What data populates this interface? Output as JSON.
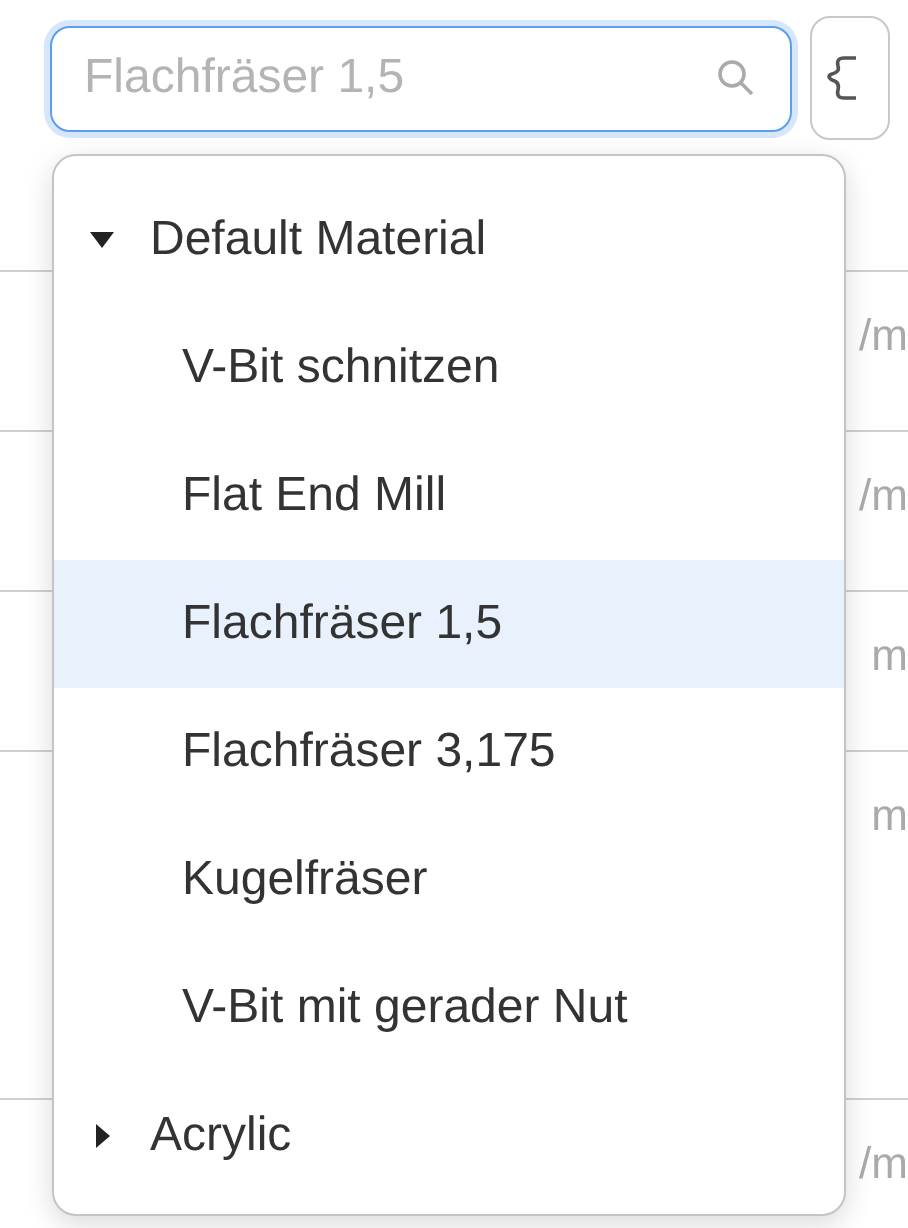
{
  "search": {
    "placeholder": "Flachfräser 1,5",
    "focused": true
  },
  "tree": [
    {
      "label": "Default Material",
      "expanded": true,
      "selected": false,
      "children": [
        {
          "label": "V-Bit schnitzen",
          "selected": false
        },
        {
          "label": "Flat End Mill",
          "selected": false
        },
        {
          "label": "Flachfräser 1,5",
          "selected": true
        },
        {
          "label": "Flachfräser 3,175",
          "selected": false
        },
        {
          "label": "Kugelfräser",
          "selected": false
        },
        {
          "label": "V-Bit mit gerader Nut",
          "selected": false
        }
      ]
    },
    {
      "label": "Acrylic",
      "expanded": false,
      "selected": false
    }
  ],
  "background_fields": [
    {
      "unit": "/m"
    },
    {
      "unit": "/m"
    },
    {
      "unit": "m"
    },
    {
      "unit": "m"
    },
    {
      "unit": "/m"
    }
  ]
}
